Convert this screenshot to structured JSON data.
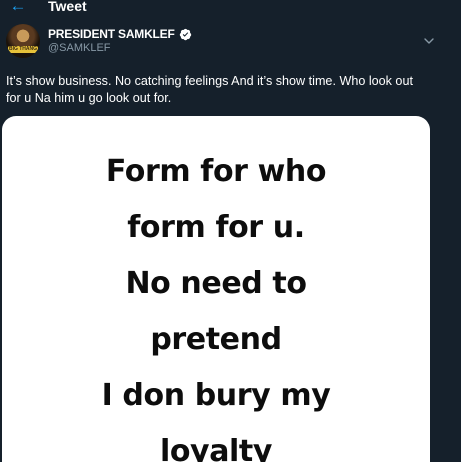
{
  "header": {
    "back_icon": "arrow-left-icon",
    "title": "Tweet"
  },
  "tweet": {
    "author": {
      "display_name": "PRESIDENT SAMKLEF",
      "handle": "@SAMKLEF",
      "verified": true,
      "avatar_caption": "BIG THANG"
    },
    "text": "It’s show business. No catching feelings And it’s show time.  Who look out for u Na him u go look out for.",
    "more_icon": "chevron-down-icon",
    "media": {
      "lines": [
        "Form for who",
        "form for u.",
        "No need to",
        "pretend",
        "I don bury my",
        "loyalty"
      ]
    }
  },
  "colors": {
    "background": "#15202b",
    "accent": "#1da1f2",
    "secondary_text": "#8899a6",
    "media_background": "#ffffff"
  }
}
